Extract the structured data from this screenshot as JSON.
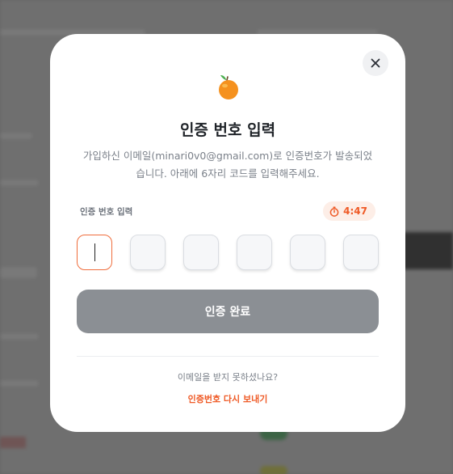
{
  "modal": {
    "title": "인증 번호 입력",
    "description_line1": "가입하신 이메일(minari0v0@gmail.com)로 인증번호가 발송되었",
    "description_line2": "습니다. 아래에 6자리 코드를 입력해주세요.",
    "code_label": "인증 번호 입력",
    "timer": "4:47",
    "code_digits": [
      "",
      "",
      "",
      "",
      "",
      ""
    ],
    "submit_label": "인증 완료",
    "no_email_text": "이메일을 받지 못하셨나요?",
    "resend_label": "인증번호 다시 보내기"
  },
  "icons": {
    "close": "close-icon",
    "logo": "orange-icon",
    "timer": "stopwatch-icon"
  },
  "colors": {
    "accent": "#ef5a26",
    "button_disabled": "#8b8f94",
    "title": "#1f2328",
    "muted_text": "#7b818a"
  }
}
